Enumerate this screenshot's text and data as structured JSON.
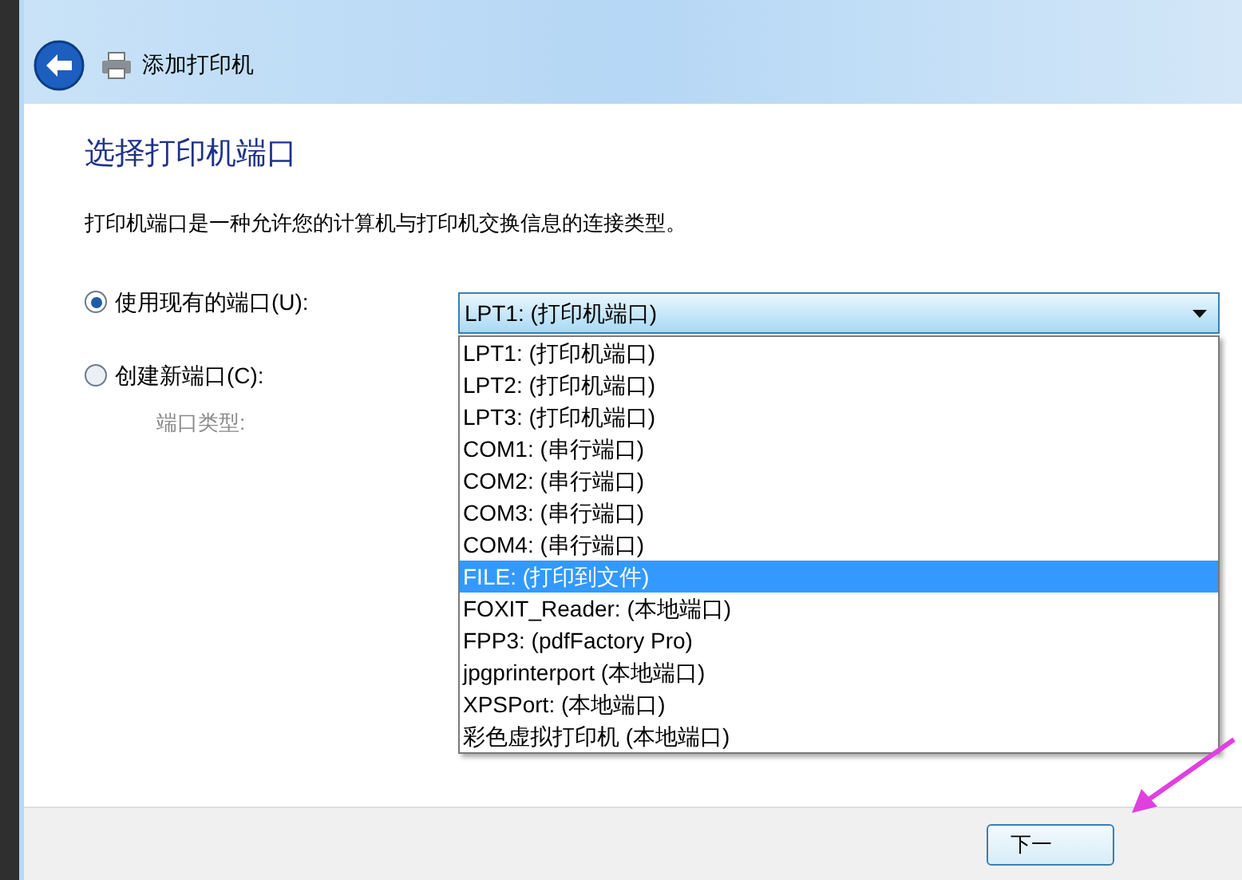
{
  "window": {
    "title": "添加打印机"
  },
  "heading": "选择打印机端口",
  "description": "打印机端口是一种允许您的计算机与打印机交换信息的连接类型。",
  "options": [
    {
      "label": "使用现有的端口(U):",
      "selected": true
    },
    {
      "label": "创建新端口(C):",
      "selected": false
    }
  ],
  "port_type_label": "端口类型:",
  "port_combo": {
    "value": "LPT1: (打印机端口)",
    "expanded": true
  },
  "port_list": [
    {
      "label": "LPT1: (打印机端口)",
      "selected": false
    },
    {
      "label": "LPT2: (打印机端口)",
      "selected": false
    },
    {
      "label": "LPT3: (打印机端口)",
      "selected": false
    },
    {
      "label": "COM1: (串行端口)",
      "selected": false
    },
    {
      "label": "COM2: (串行端口)",
      "selected": false
    },
    {
      "label": "COM3: (串行端口)",
      "selected": false
    },
    {
      "label": "COM4: (串行端口)",
      "selected": false
    },
    {
      "label": "FILE: (打印到文件)",
      "selected": true
    },
    {
      "label": "FOXIT_Reader: (本地端口)",
      "selected": false
    },
    {
      "label": "FPP3: (pdfFactory Pro)",
      "selected": false
    },
    {
      "label": "jpgprinterport (本地端口)",
      "selected": false
    },
    {
      "label": "XPSPort: (本地端口)",
      "selected": false
    },
    {
      "label": "彩色虚拟打印机 (本地端口)",
      "selected": false
    }
  ],
  "buttons": [
    "下一"
  ]
}
